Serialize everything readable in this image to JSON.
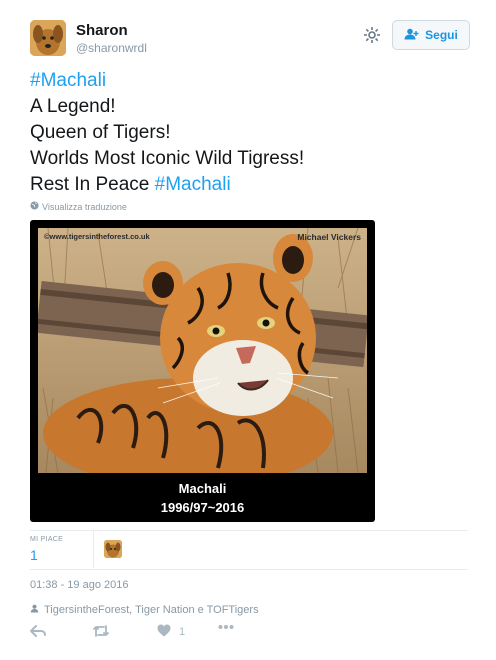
{
  "header": {
    "name": "Sharon",
    "handle": "@sharonwrdl",
    "follow_label": "Segui"
  },
  "tweet": {
    "lines": {
      "hashtag1": "#Machali",
      "line2": "A Legend!",
      "line3": "Queen of Tigers!",
      "line4": "Worlds Most Iconic Wild Tigress!",
      "line5_prefix": "Rest In Peace ",
      "line5_hashtag": "#Machali"
    },
    "translate_label": "Visualizza traduzione"
  },
  "media": {
    "watermark_left": "©www.tigersintheforest.co.uk",
    "watermark_right": "Michael Vickers",
    "caption_name": "Machali",
    "caption_years": "1996/97~2016"
  },
  "stats": {
    "likes_label": "MI PIACE",
    "likes_count": "1"
  },
  "timestamp": "01:38 - 19 ago 2016",
  "followed_by": "TigersintheForest, Tiger Nation e TOFTigers",
  "actions": {
    "like_count": "1"
  },
  "colors": {
    "accent": "#1da1f2",
    "muted": "#8899a6",
    "text": "#14171a"
  },
  "icons": [
    "gear-icon",
    "follow-user-icon",
    "globe-icon",
    "user-icon",
    "reply-icon",
    "retweet-icon",
    "heart-icon",
    "more-icon"
  ]
}
